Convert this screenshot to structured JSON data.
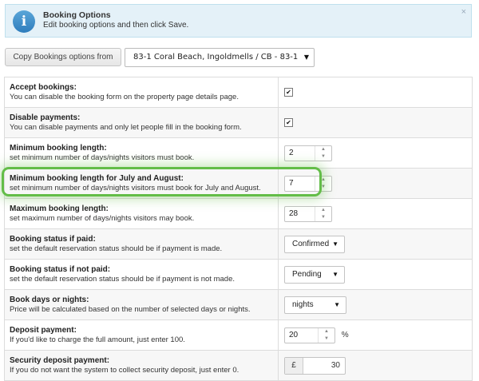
{
  "banner": {
    "title": "Booking Options",
    "text": "Edit booking options and then click Save.",
    "close_glyph": "×",
    "icon": "info-icon"
  },
  "copy_bar": {
    "button_label": "Copy Bookings options from",
    "property_value": "83-1 Coral Beach, Ingoldmells / CB - 83-1"
  },
  "rows": [
    {
      "title": "Accept bookings:",
      "desc": "You can disable the booking form on the property page details page.",
      "checked": true
    },
    {
      "title": "Disable payments:",
      "desc": "You can disable payments and only let people fill in the booking form.",
      "checked": true
    },
    {
      "title": "Minimum booking length:",
      "desc": "set minimum number of days/nights visitors must book.",
      "value": "2"
    },
    {
      "title": "Minimum booking length for July and August:",
      "desc": "set minimum number of days/nights visitors must book for July and August.",
      "value": "7"
    },
    {
      "title": "Maximum booking length:",
      "desc": "set maximum number of days/nights visitors may book.",
      "value": "28"
    },
    {
      "title": "Booking status if paid:",
      "desc": "set the default reservation status should be if payment is made.",
      "value": "Confirmed"
    },
    {
      "title": "Booking status if not paid:",
      "desc": "set the default reservation status should be if payment is not made.",
      "value": "Pending"
    },
    {
      "title": "Book days or nights:",
      "desc": "Price will be calculated based on the number of selected days or nights.",
      "value": "nights"
    },
    {
      "title": "Deposit payment:",
      "desc": "If you'd like to charge the full amount, just enter 100.",
      "value": "20",
      "unit": "%"
    },
    {
      "title": "Security deposit payment:",
      "desc": "If you do not want the system to collect security deposit, just enter 0.",
      "currency": "£",
      "value": "30"
    }
  ],
  "glyphs": {
    "check": "✔",
    "up": "▲",
    "down": "▼",
    "caret": "▼"
  },
  "colors": {
    "highlight": "#63bd48",
    "banner_bg": "#e4f1f8"
  }
}
